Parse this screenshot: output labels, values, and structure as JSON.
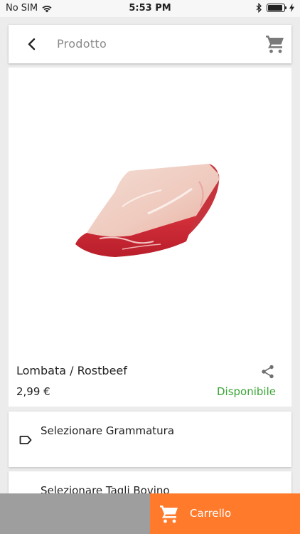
{
  "status_bar": {
    "carrier": "No SIM",
    "time": "5:53 PM",
    "wifi_icon": "wifi-icon",
    "bluetooth_icon": "bluetooth-icon",
    "battery_icon": "battery-icon",
    "charging_icon": "charging-bolt-icon",
    "battery_level": 0.9
  },
  "header": {
    "title": "Prodotto",
    "back_icon": "chevron-left-icon",
    "cart_icon": "cart-icon"
  },
  "product": {
    "image_icon": "meat-image",
    "name": "Lombata / Rostbeef",
    "price": "2,99 €",
    "availability": "Disponibile",
    "availability_color": "#3aa535",
    "share_icon": "share-icon"
  },
  "options": {
    "grammatura_label": "Selezionare Grammatura",
    "tagli_label": "Selezionare Tagli Bovino",
    "tag_icon": "tag-icon"
  },
  "bottom_bar": {
    "cart_label": "Carrello",
    "cart_color": "#ff7a2b"
  }
}
